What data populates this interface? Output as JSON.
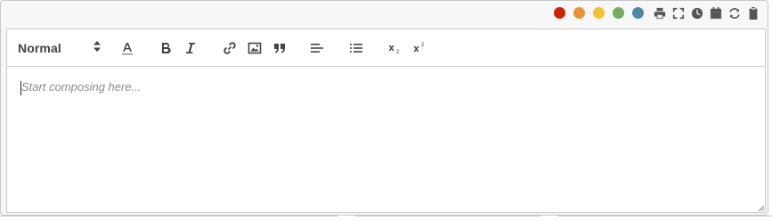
{
  "window_controls": {
    "color_dots": [
      {
        "name": "red-dot",
        "color": "#cc2200"
      },
      {
        "name": "orange-dot",
        "color": "#e8923a"
      },
      {
        "name": "yellow-dot",
        "color": "#f2c233"
      },
      {
        "name": "green-dot",
        "color": "#77ad5c"
      },
      {
        "name": "teal-dot",
        "color": "#4f88a4"
      }
    ],
    "icons": [
      "print-icon",
      "fullscreen-icon",
      "clock-icon",
      "calendar-icon",
      "refresh-icon",
      "clipboard-icon"
    ]
  },
  "toolbar": {
    "format_select": {
      "value": "Normal"
    },
    "buttons": [
      "text-color-icon",
      "bold-icon",
      "italic-icon",
      "link-icon",
      "image-icon",
      "blockquote-icon",
      "align-left-icon",
      "bullet-list-icon",
      "subscript-icon",
      "superscript-icon"
    ]
  },
  "editor": {
    "placeholder": "Start composing here..."
  }
}
